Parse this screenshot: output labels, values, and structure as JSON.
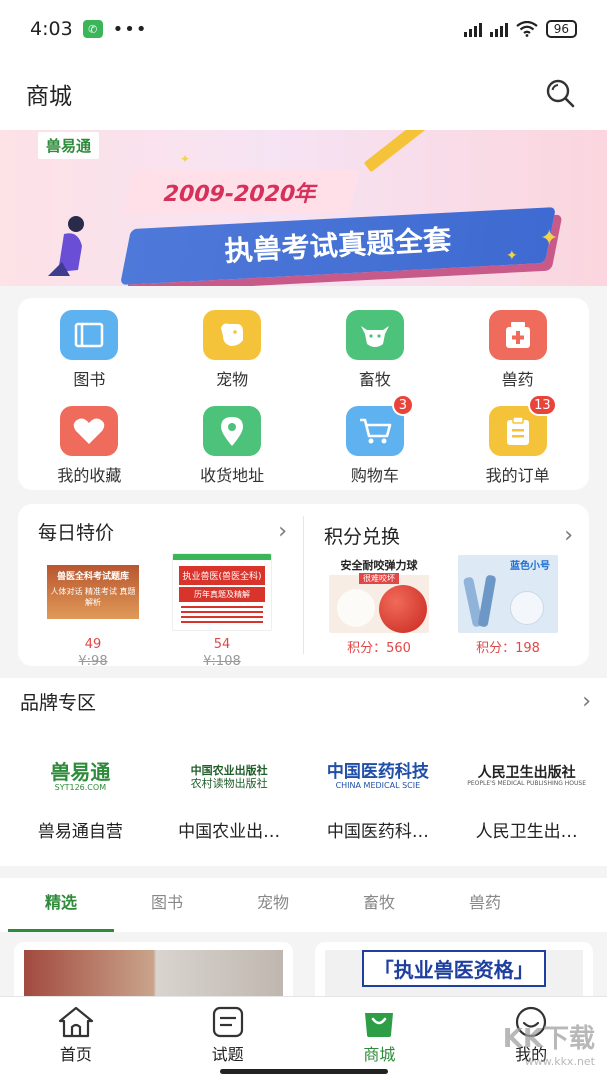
{
  "statusbar": {
    "time": "4:03",
    "dots": "•••",
    "battery": "96"
  },
  "header": {
    "title": "商城"
  },
  "banner": {
    "brand": "兽易通",
    "years": "2009-2020年",
    "headline": "执兽考试真题全套"
  },
  "categories": [
    {
      "label": "图书",
      "icon": "book-icon",
      "color": "#5fb2f0"
    },
    {
      "label": "宠物",
      "icon": "dog-icon",
      "color": "#f5c33a"
    },
    {
      "label": "畜牧",
      "icon": "cow-icon",
      "color": "#4cc27a"
    },
    {
      "label": "兽药",
      "icon": "medicine-icon",
      "color": "#ef6b5b"
    },
    {
      "label": "我的收藏",
      "icon": "heart-icon",
      "color": "#ef6b5b"
    },
    {
      "label": "收货地址",
      "icon": "location-icon",
      "color": "#4cc27a"
    },
    {
      "label": "购物车",
      "icon": "cart-icon",
      "color": "#5fb2f0",
      "badge": "3"
    },
    {
      "label": "我的订单",
      "icon": "order-icon",
      "color": "#f5c33a",
      "badge": "13"
    }
  ],
  "deals": {
    "daily": {
      "title": "每日特价",
      "items": [
        {
          "price": "49",
          "old": "¥:98",
          "book_title": "兽医全科考试题库",
          "book_sub": "人体对话 精准考试 真题解析"
        },
        {
          "price": "54",
          "old": "¥:108",
          "book_title": "执业兽医(兽医全科)",
          "book_sub": "历年真题及精解"
        }
      ]
    },
    "points": {
      "title": "积分兑换",
      "items": [
        {
          "points": "积分：560",
          "caption": "安全耐咬弹力球",
          "sub": "很难咬坏"
        },
        {
          "points": "积分：198",
          "caption": "蓝色小号"
        }
      ]
    }
  },
  "brands": {
    "title": "品牌专区",
    "items": [
      {
        "name": "兽易通自营",
        "logo_text": "兽易通",
        "logo_sub": "SYT126.COM"
      },
      {
        "name": "中国农业出…",
        "logo_text": "中国农业出版社",
        "logo_sub": "农村读物出版社"
      },
      {
        "name": "中国医药科…",
        "logo_text": "中国医药科技",
        "logo_sub": "CHINA MEDICAL SCIE"
      },
      {
        "name": "人民卫生出…",
        "logo_text": "人民卫生出版社",
        "logo_sub": "PEOPLE'S MEDICAL PUBLISHING HOUSE"
      }
    ]
  },
  "tabs": [
    "精选",
    "图书",
    "宠物",
    "畜牧",
    "兽药"
  ],
  "products": {
    "b_title": "「执业兽医资格」"
  },
  "bottomnav": [
    {
      "label": "首页",
      "icon": "home-icon"
    },
    {
      "label": "试题",
      "icon": "exam-icon"
    },
    {
      "label": "商城",
      "icon": "shop-bag-icon"
    },
    {
      "label": "我的",
      "icon": "profile-icon"
    }
  ],
  "watermark": {
    "big": "KK下载",
    "small": "www.kkx.net"
  }
}
